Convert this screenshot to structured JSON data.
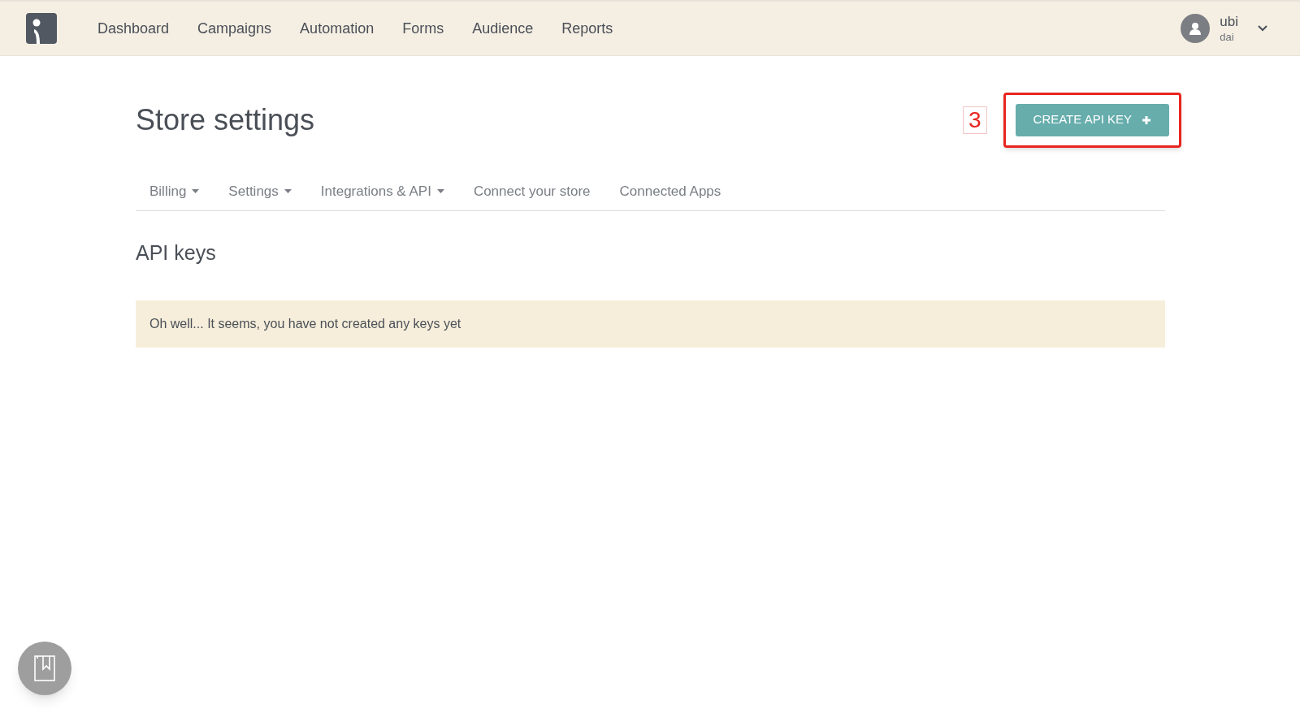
{
  "nav": {
    "items": [
      "Dashboard",
      "Campaigns",
      "Automation",
      "Forms",
      "Audience",
      "Reports"
    ],
    "user": {
      "name": "ubi",
      "subtitle": "dai"
    }
  },
  "page": {
    "title": "Store settings",
    "step_label": "3",
    "create_button": "CREATE API KEY",
    "tabs": [
      {
        "label": "Billing",
        "dropdown": true
      },
      {
        "label": "Settings",
        "dropdown": true
      },
      {
        "label": "Integrations & API",
        "dropdown": true
      },
      {
        "label": "Connect your store",
        "dropdown": false
      },
      {
        "label": "Connected Apps",
        "dropdown": false
      }
    ],
    "section_title": "API keys",
    "empty_message": "Oh well... It seems, you have not created any keys yet"
  }
}
